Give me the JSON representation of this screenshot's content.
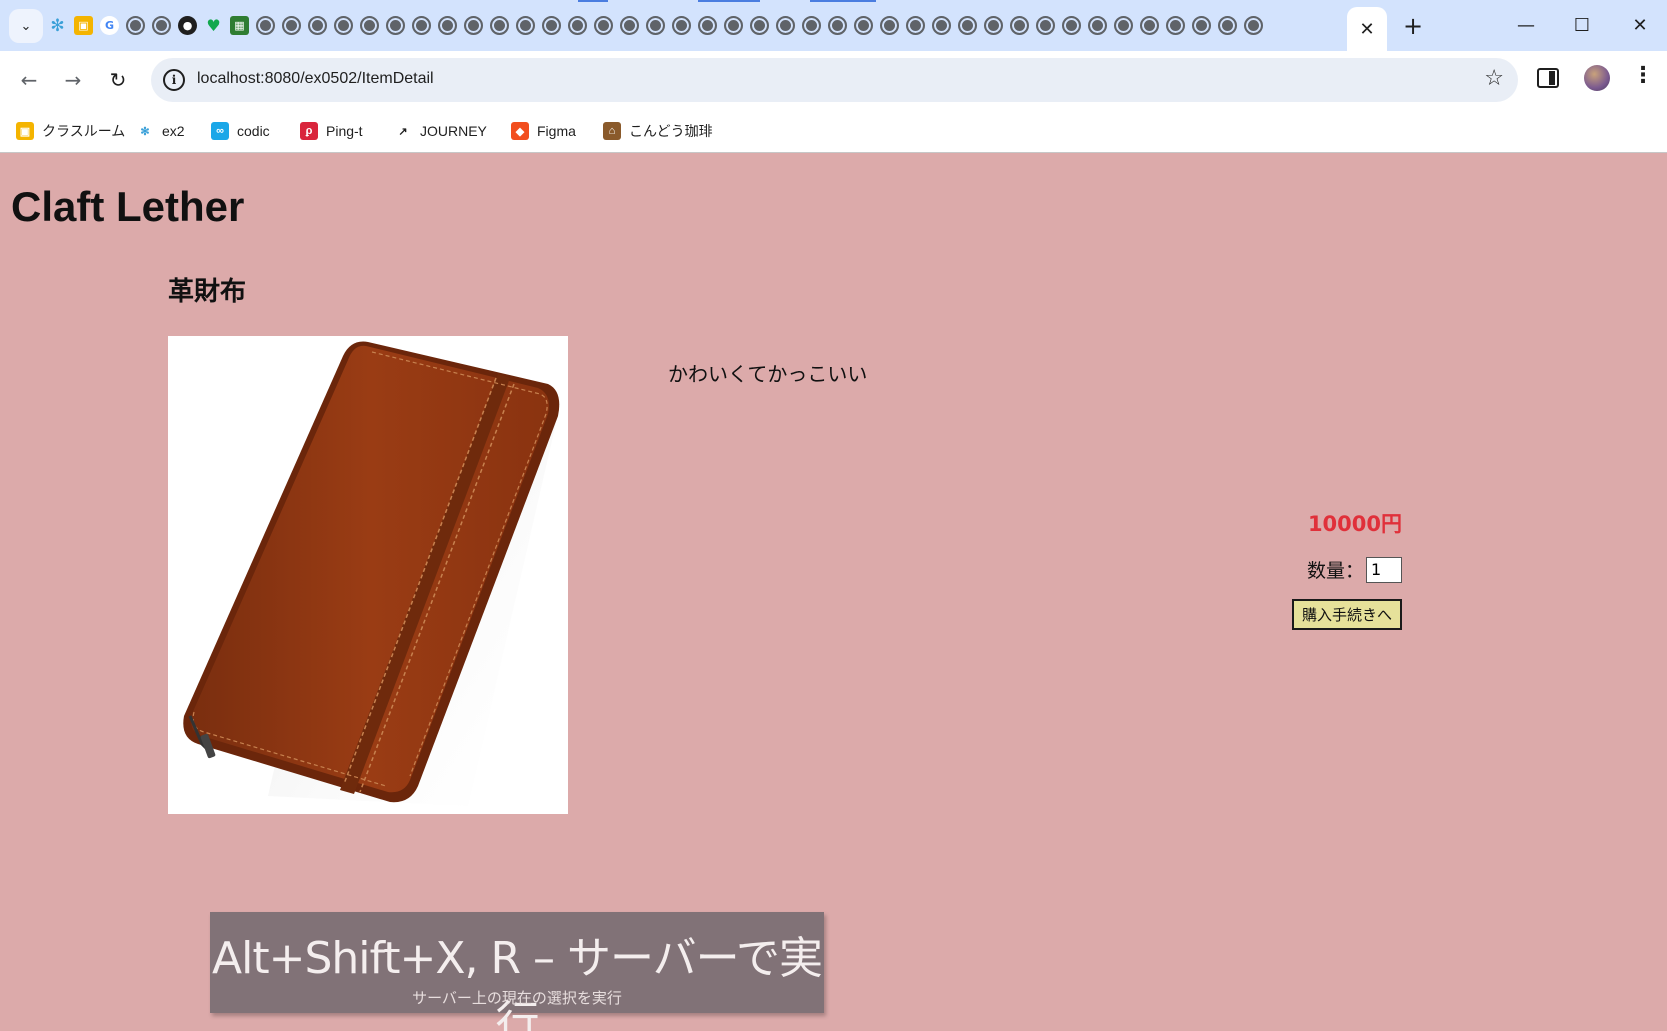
{
  "browser": {
    "tab_search_icon": "chevron-down-icon",
    "active_tab_close": "✕",
    "new_tab": "+",
    "window": {
      "minimize": "—",
      "maximize": "☐",
      "close": "✕"
    },
    "url": "localhost:8080/ex0502/ItemDetail",
    "nav": {
      "back": "←",
      "forward": "→",
      "reload": "↻"
    }
  },
  "bookmarks": [
    {
      "label": "クラスルーム",
      "icon": "classroom-icon",
      "color": "#f4b400"
    },
    {
      "label": "ex2",
      "icon": "ex2-icon",
      "color": "#3aa0d8"
    },
    {
      "label": "codic",
      "icon": "codic-icon",
      "color": "#1aa7e8"
    },
    {
      "label": "Ping-t",
      "icon": "ping-t-icon",
      "color": "#d9253c"
    },
    {
      "label": "JOURNEY",
      "icon": "journey-icon",
      "color": "#1f1f1f"
    },
    {
      "label": "Figma",
      "icon": "figma-icon",
      "color": "#f24e1e"
    },
    {
      "label": "こんどう珈琲",
      "icon": "house-icon",
      "color": "#8a5a2b"
    }
  ],
  "page": {
    "site_title": "Claft Lether",
    "item_name": "革財布",
    "item_description": "かわいくてかっこいい",
    "price": "10000円",
    "quantity_label": "数量：",
    "quantity_value": "1",
    "buy_button": "購入手続きへ"
  },
  "toast": {
    "title": "Alt+Shift+X, R – サーバーで実行",
    "subtitle": "サーバー上の現在の選択を実行"
  },
  "colors": {
    "page_background": "#dcaaaa",
    "price": "#e0303a",
    "buy_button": "#e6e19a",
    "tabstrip": "#d3e3fd"
  }
}
